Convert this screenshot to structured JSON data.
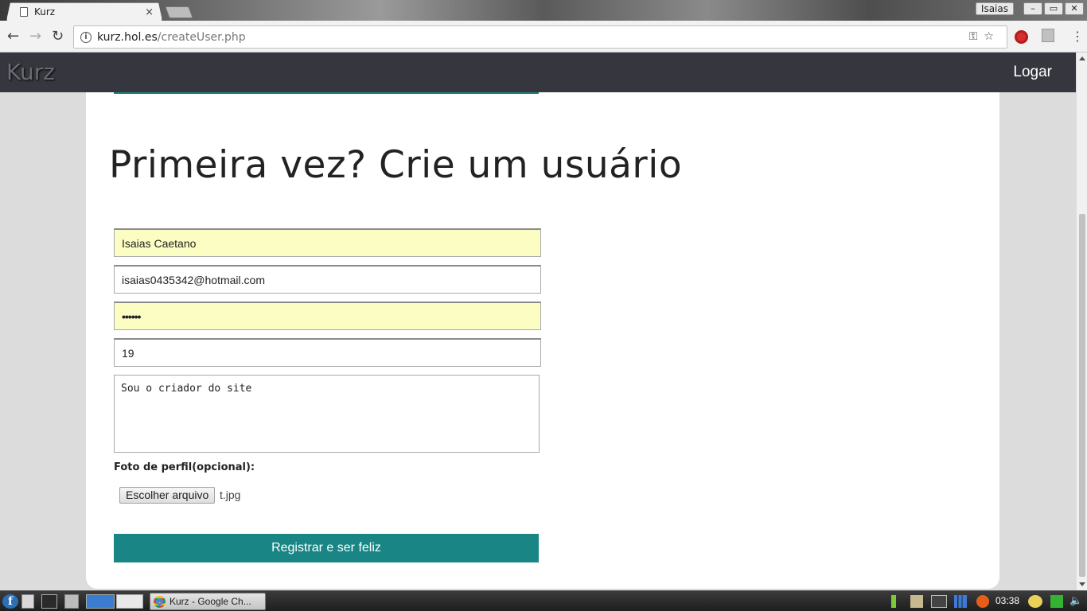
{
  "browser": {
    "tab_title": "Kurz",
    "tab_close": "×",
    "user_badge": "Isaias",
    "window_controls": {
      "minimize": "–",
      "restore": "▭",
      "close": "✕"
    },
    "nav": {
      "back": "←",
      "forward": "→",
      "reload": "↻"
    },
    "url_host": "kurz.hol.es",
    "url_path": "/createUser.php",
    "omnibox_icons": "⚿☆",
    "menu": "⋮"
  },
  "site": {
    "logo": "Kurz",
    "login_link": "Logar"
  },
  "form": {
    "heading": "Primeira vez? Crie um usuário",
    "name_value": "Isaias Caetano",
    "email_value": "isaias0435342@hotmail.com",
    "password_value": "••••••",
    "age_value": "19",
    "bio_value": "Sou o criador do site",
    "photo_label": "Foto de perfil(opcional):",
    "file_button": "Escolher arquivo",
    "file_name": "t.jpg",
    "submit_label": "Registrar e ser feliz"
  },
  "taskbar": {
    "start_glyph": "f",
    "task_label": "Kurz - Google Ch...",
    "clock": "03:38",
    "volume_glyph": "🔈"
  },
  "colors": {
    "site_nav": "#36363f",
    "accent_teal": "#1a8585",
    "autofill": "#fbfdc2"
  }
}
